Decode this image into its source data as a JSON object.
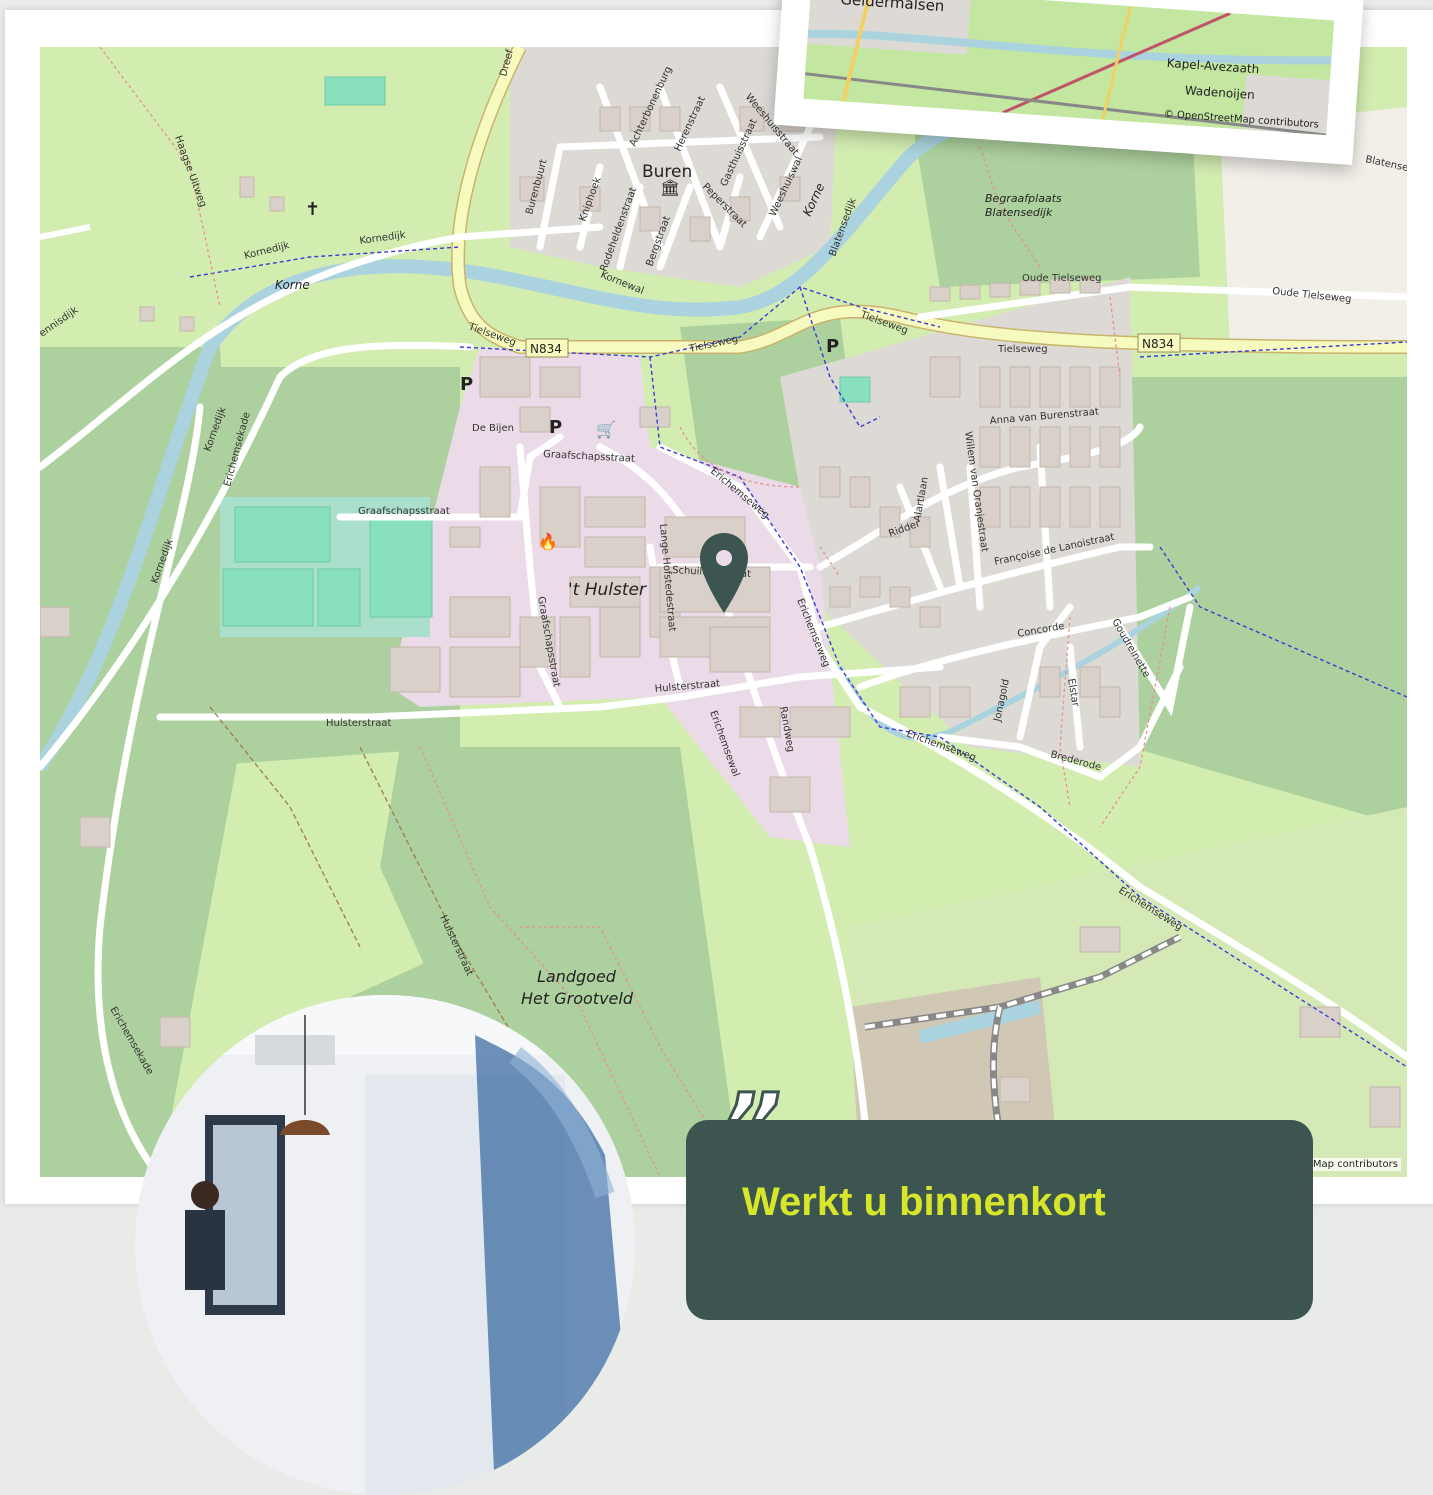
{
  "map": {
    "town_label": "Buren",
    "industrial_label": "'t Hulster",
    "estate_label_1": "Landgoed",
    "estate_label_2": "Het Grootveld",
    "cemetery_label_1": "Begraafplaats",
    "cemetery_label_2": "Blatensedijk",
    "river_label": "Korne",
    "road_shield": "N834",
    "parking_symbol": "P",
    "attribution": "Map contributors",
    "streets": {
      "tielseweg": "Tielseweg",
      "oude_tielseweg": "Oude Tielseweg",
      "kornedijk": "Kornedijk",
      "erichemsekade": "Erichemsekade",
      "erichemseweg": "Erichemseweg",
      "erichemsewal": "Erichemsewal",
      "hulsterstraat": "Hulsterstraat",
      "graafschapsstraat": "Graafschapsstraat",
      "de_bijen": "De Bijen",
      "lange_hofstedestraat": "Lange Hofstedestraat",
      "schuiltuinstraat": "Schuiltuinstraat",
      "randweg": "Randweg",
      "concorde": "Concorde",
      "goudreinette": "Goudreinette",
      "jonagold": "Jonagold",
      "elstar": "Elstar",
      "brederode": "Brederode",
      "francoise": "Françoise de Lanoistraat",
      "willem": "Willem van Oranjestraat",
      "anna": "Anna van Burenstraat",
      "ridder": "Ridder",
      "alartlaan": "Alartlaan",
      "blatensedijk": "Blatensedijk",
      "blatense": "Blatense",
      "weeshuiswal": "Weeshuiswal",
      "weeshuisstraat": "Weeshuisstraat",
      "gasthuisstraat": "Gasthuisstraat",
      "herenstraat": "Herenstraat",
      "peperstraat": "Peperstraat",
      "bergstraat": "Bergstraat",
      "rodeheldenstraat": "Rodeheldenstraat",
      "kniphoek": "Kniphoek",
      "burenbuurt": "Burenbuurt",
      "kornewal": "Kornewal",
      "achterbonenburg": "Achterbonenburg",
      "haagse_uitweg": "Haagse Uitweg",
      "dreef": "Dreef",
      "ennisdijk": "ennisdijk"
    }
  },
  "inset": {
    "place_1": "Geldermalsen",
    "place_2": "Kapel-Avezaath",
    "place_3": "Wadenoijen",
    "attribution": "© OpenStreetMap contributors"
  },
  "quote": {
    "mark": "”",
    "title": "Werkt u binnenkort"
  },
  "colors": {
    "accent_dark": "#3d5551",
    "accent_lime": "#d8e629",
    "marker": "#3d5551"
  }
}
